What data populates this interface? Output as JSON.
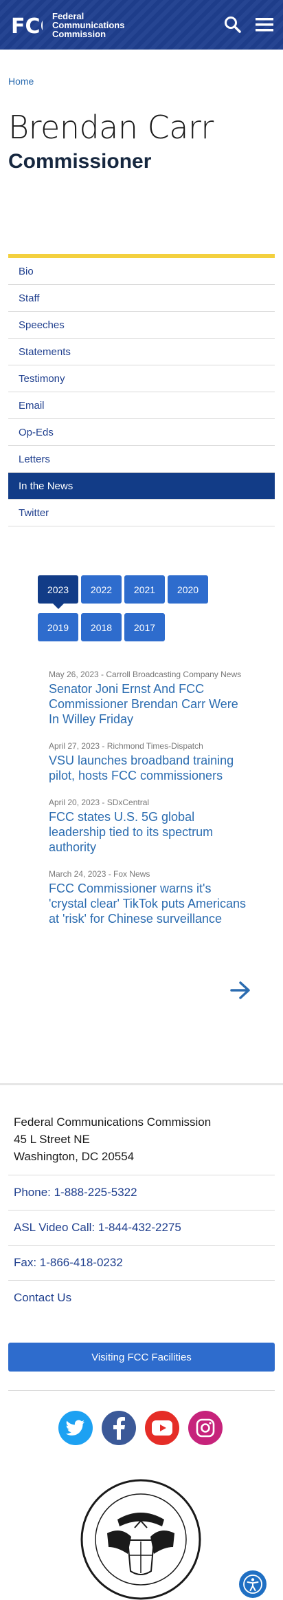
{
  "header": {
    "brand_line1": "Federal",
    "brand_line2": "Communications",
    "brand_line3": "Commission",
    "logo_text": "FCC",
    "search_icon": "search-icon",
    "menu_icon": "hamburger-icon"
  },
  "breadcrumb": {
    "home": "Home"
  },
  "person": {
    "name": "Brendan Carr",
    "role": "Commissioner"
  },
  "nav": {
    "items": [
      {
        "label": "Bio"
      },
      {
        "label": "Staff"
      },
      {
        "label": "Speeches"
      },
      {
        "label": "Statements"
      },
      {
        "label": "Testimony"
      },
      {
        "label": "Email"
      },
      {
        "label": "Op-Eds"
      },
      {
        "label": "Letters"
      },
      {
        "label": "In the News",
        "active": true
      },
      {
        "label": "Twitter"
      }
    ]
  },
  "years": [
    "2023",
    "2022",
    "2021",
    "2020",
    "2019",
    "2018",
    "2017"
  ],
  "active_year": "2023",
  "news": [
    {
      "meta": "May 26, 2023 - Carroll Broadcasting Company News",
      "title": "Senator Joni Ernst And FCC Commissioner Brendan Carr Were In Willey Friday"
    },
    {
      "meta": "April 27, 2023 - Richmond Times-Dispatch",
      "title": "VSU launches broadband training pilot, hosts FCC commissioners"
    },
    {
      "meta": "April 20, 2023 - SDxCentral",
      "title": "FCC states U.S. 5G global leadership tied to its spectrum authority"
    },
    {
      "meta": "March 24, 2023 - Fox News",
      "title": "FCC Commissioner warns it's 'crystal clear' TikTok puts Americans at 'risk' for Chinese surveillance"
    }
  ],
  "footer": {
    "address_line1": "Federal Communications Commission",
    "address_line2": "45 L Street NE",
    "address_line3": "Washington, DC 20554",
    "phone": "Phone: 1-888-225-5322",
    "asl": "ASL Video Call: 1-844-432-2275",
    "fax": "Fax: 1-866-418-0232",
    "contact": "Contact Us",
    "visit": "Visiting FCC Facilities"
  },
  "social": [
    "twitter-icon",
    "facebook-icon",
    "youtube-icon",
    "instagram-icon"
  ],
  "colors": {
    "header_bg": "#1f3f8e",
    "accent": "#2e6ccd",
    "active": "#123c87",
    "nav_top_border": "#f3d03e",
    "link": "#2b6cb0"
  }
}
